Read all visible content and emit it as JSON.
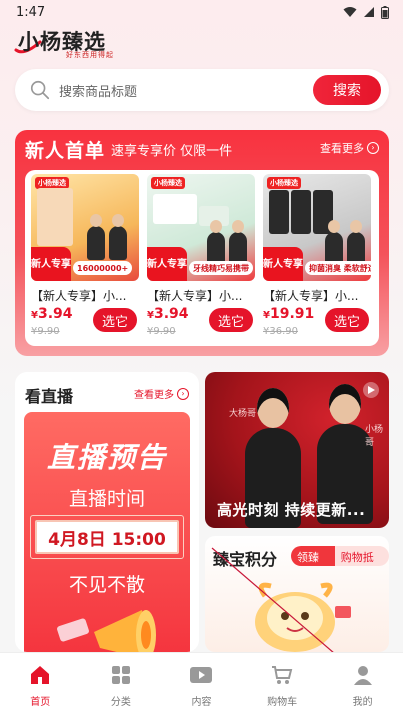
{
  "status_bar": {
    "time": "1:47"
  },
  "brand": {
    "name": "小杨臻选",
    "tagline": "好东西用得起"
  },
  "search": {
    "placeholder": "搜索商品标题",
    "button": "搜索"
  },
  "newcomer": {
    "title": "新人首单",
    "subtitle": "速享专享价 仅限一件",
    "more": "查看更多",
    "products": [
      {
        "name": "【新人专享】小...",
        "price_symbol": "¥",
        "price": "3.94",
        "original_price": "¥9.90",
        "button": "选它",
        "badge": "新人专享",
        "promo": "16000000+"
      },
      {
        "name": "【新人专享】小...",
        "price_symbol": "¥",
        "price": "3.94",
        "original_price": "¥9.90",
        "button": "选它",
        "badge": "新人专享",
        "promo": "牙线精巧易携带"
      },
      {
        "name": "【新人专享】小...",
        "price_symbol": "¥",
        "price": "19.91",
        "original_price": "¥36.90",
        "button": "选它",
        "badge": "新人专享",
        "promo": "抑菌消臭 柔软舒适"
      }
    ]
  },
  "live": {
    "title": "看直播",
    "more": "查看更多",
    "poster_headline": "直播预告",
    "poster_time_label": "直播时间",
    "poster_date": "4月8日 15:00",
    "poster_slogan": "不见不散"
  },
  "highlight": {
    "caption": "高光时刻 持续更新...",
    "left_name": "大杨哥",
    "right_name": "小杨哥"
  },
  "points": {
    "title": "臻宝积分",
    "tag_left": "领臻宝",
    "tag_right": "购物抵扣"
  },
  "tabbar": [
    {
      "label": "首页",
      "icon": "home-icon",
      "active": true
    },
    {
      "label": "分类",
      "icon": "category-icon",
      "active": false
    },
    {
      "label": "内容",
      "icon": "video-icon",
      "active": false
    },
    {
      "label": "购物车",
      "icon": "cart-icon",
      "active": false
    },
    {
      "label": "我的",
      "icon": "profile-icon",
      "active": false
    }
  ],
  "colors": {
    "accent": "#e5142a",
    "panel_red": "#f8323f"
  }
}
